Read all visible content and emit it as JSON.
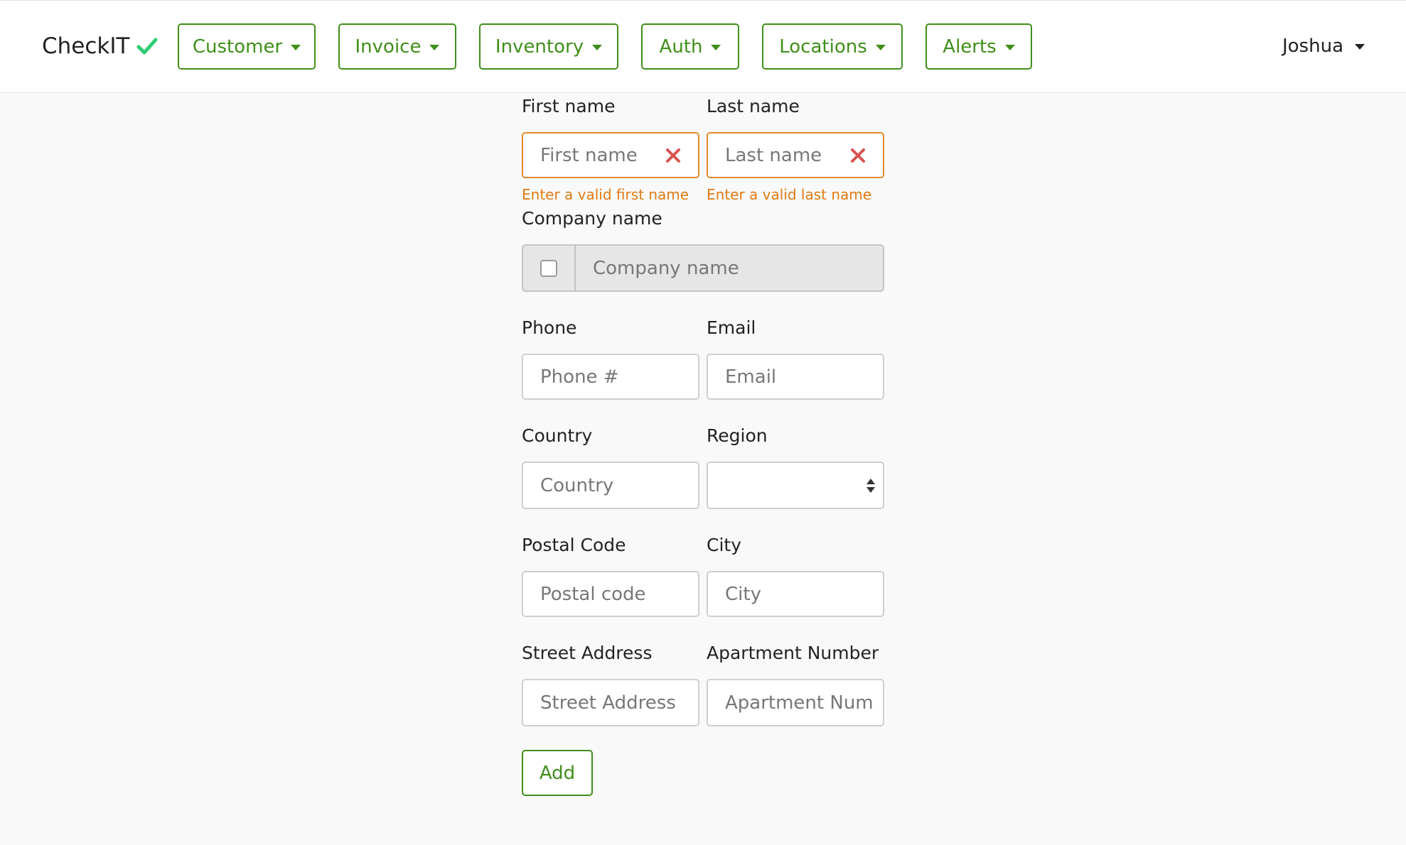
{
  "brand": {
    "name": "CheckIT",
    "check_color": "#2ecc71"
  },
  "nav": {
    "items": [
      {
        "label": "Customer"
      },
      {
        "label": "Invoice"
      },
      {
        "label": "Inventory"
      },
      {
        "label": "Auth"
      },
      {
        "label": "Locations"
      },
      {
        "label": "Alerts"
      }
    ],
    "accent_color": "#3f8f1a"
  },
  "user": {
    "name": "Joshua"
  },
  "form": {
    "first_name": {
      "label": "First name",
      "placeholder": "First name",
      "error": "Enter a valid first name"
    },
    "last_name": {
      "label": "Last name",
      "placeholder": "Last name",
      "error": "Enter a valid last name"
    },
    "company": {
      "label": "Company name",
      "placeholder": "Company name",
      "checked": false
    },
    "phone": {
      "label": "Phone",
      "placeholder": "Phone #"
    },
    "email": {
      "label": "Email",
      "placeholder": "Email"
    },
    "country": {
      "label": "Country",
      "placeholder": "Country"
    },
    "region": {
      "label": "Region",
      "value": ""
    },
    "postal": {
      "label": "Postal Code",
      "placeholder": "Postal code"
    },
    "city": {
      "label": "City",
      "placeholder": "City"
    },
    "street": {
      "label": "Street Address",
      "placeholder": "Street Address"
    },
    "apartment": {
      "label": "Apartment Number",
      "placeholder": "Apartment Num"
    },
    "submit_label": "Add",
    "error_color": "#e07a12",
    "invalid_border_color": "#e08a2c",
    "clear_icon_color": "#d9534f"
  }
}
